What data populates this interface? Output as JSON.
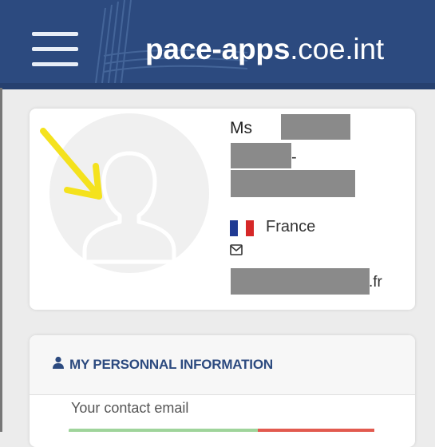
{
  "header": {
    "title_bold": "pace-apps",
    "title_rest": ".coe.int",
    "background_color": "#2c4a7f"
  },
  "profile": {
    "salutation": "Ms",
    "name_suffix": "-",
    "country": "France",
    "country_flag": "flag-france",
    "email_suffix": ".fr",
    "avatar_icon": "user-silhouette-icon",
    "annotation": "yellow-arrow"
  },
  "personal_info": {
    "section_title": "MY PERSONNAL INFORMATION",
    "section_icon": "user-icon",
    "contact_email_label": "Your contact email"
  }
}
